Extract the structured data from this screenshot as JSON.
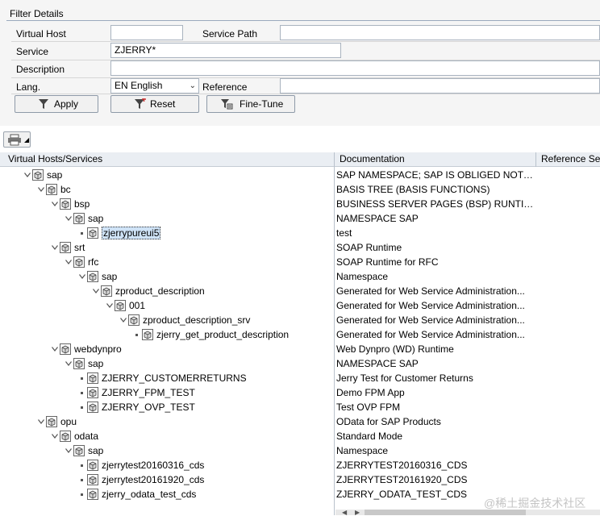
{
  "filter": {
    "title": "Filter Details",
    "virtual_host_label": "Virtual Host",
    "virtual_host_value": "",
    "service_path_label": "Service Path",
    "service_path_value": "",
    "service_label": "Service",
    "service_value": "ZJERRY*",
    "description_label": "Description",
    "description_value": "",
    "lang_label": "Lang.",
    "lang_value": "EN English",
    "reference_label": "Reference",
    "reference_value": "",
    "apply_label": "Apply",
    "reset_label": "Reset",
    "finetune_label": "Fine-Tune"
  },
  "columns": {
    "tree": "Virtual Hosts/Services",
    "doc": "Documentation",
    "ref": "Reference Se"
  },
  "tree": [
    {
      "label": "sap",
      "doc": "SAP NAMESPACE; SAP IS OBLIGED NOT T...",
      "level": 0,
      "expanded": true
    },
    {
      "label": "bc",
      "doc": "BASIS TREE (BASIS FUNCTIONS)",
      "level": 1,
      "expanded": true
    },
    {
      "label": "bsp",
      "doc": "BUSINESS SERVER PAGES (BSP) RUNTIME",
      "level": 2,
      "expanded": true
    },
    {
      "label": "sap",
      "doc": "NAMESPACE SAP",
      "level": 3,
      "expanded": true
    },
    {
      "label": "zjerrypureui5",
      "doc": "test",
      "level": 4,
      "leaf": true,
      "selected": true
    },
    {
      "label": "srt",
      "doc": "SOAP Runtime",
      "level": 2,
      "expanded": true
    },
    {
      "label": "rfc",
      "doc": "SOAP Runtime for RFC",
      "level": 3,
      "expanded": true
    },
    {
      "label": "sap",
      "doc": "Namespace",
      "level": 4,
      "expanded": true
    },
    {
      "label": "zproduct_description",
      "doc": "Generated for Web Service Administration...",
      "level": 5,
      "expanded": true
    },
    {
      "label": "001",
      "doc": "Generated for Web Service Administration...",
      "level": 6,
      "expanded": true
    },
    {
      "label": "zproduct_description_srv",
      "doc": "Generated for Web Service Administration...",
      "level": 7,
      "expanded": true
    },
    {
      "label": "zjerry_get_product_description",
      "doc": "Generated for Web Service Administration...",
      "level": 8,
      "leaf": true
    },
    {
      "label": "webdynpro",
      "doc": "Web Dynpro (WD) Runtime",
      "level": 2,
      "expanded": true
    },
    {
      "label": "sap",
      "doc": "NAMESPACE SAP",
      "level": 3,
      "expanded": true
    },
    {
      "label": "ZJERRY_CUSTOMERRETURNS",
      "doc": "Jerry Test for Customer Returns",
      "level": 4,
      "leaf": true
    },
    {
      "label": "ZJERRY_FPM_TEST",
      "doc": "Demo FPM App",
      "level": 4,
      "leaf": true
    },
    {
      "label": "ZJERRY_OVP_TEST",
      "doc": "Test OVP FPM",
      "level": 4,
      "leaf": true
    },
    {
      "label": "opu",
      "doc": "OData for SAP Products",
      "level": 1,
      "expanded": true
    },
    {
      "label": "odata",
      "doc": "Standard Mode",
      "level": 2,
      "expanded": true
    },
    {
      "label": "sap",
      "doc": "Namespace",
      "level": 3,
      "expanded": true
    },
    {
      "label": "zjerrytest20160316_cds",
      "doc": "ZJERRYTEST20160316_CDS",
      "level": 4,
      "leaf": true
    },
    {
      "label": "zjerrytest20161920_cds",
      "doc": "ZJERRYTEST20161920_CDS",
      "level": 4,
      "leaf": true
    },
    {
      "label": "zjerry_odata_test_cds",
      "doc": "ZJERRY_ODATA_TEST_CDS",
      "level": 4,
      "leaf": true
    }
  ],
  "watermark": "@稀土掘金技术社区"
}
